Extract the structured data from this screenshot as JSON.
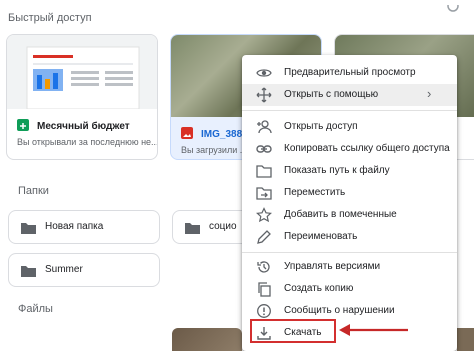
{
  "quick_access": {
    "title": "Быстрый доступ",
    "cards": [
      {
        "name": "Месячный бюджет",
        "subtitle": "Вы открывали за последнюю не...",
        "icon": "sheets-icon",
        "color": "#0f9d58"
      },
      {
        "name": "IMG_3887",
        "subtitle": "Вы загрузили ...",
        "icon": "image-icon",
        "color": "#d93025"
      }
    ],
    "preview_doc_title": "Месячный бюджет"
  },
  "folders": {
    "title": "Папки",
    "items": [
      {
        "label": "Новая папка"
      },
      {
        "label": "социо"
      },
      {
        "label": "Summer"
      }
    ]
  },
  "files": {
    "title": "Файлы"
  },
  "context_menu": {
    "items": [
      {
        "label": "Предварительный просмотр",
        "icon": "eye-icon"
      },
      {
        "label": "Открыть с помощью",
        "icon": "move-arrows-icon",
        "submenu_glyph": "›"
      },
      {
        "label": "Открыть доступ",
        "icon": "add-person-icon"
      },
      {
        "label": "Копировать ссылку общего доступа",
        "icon": "link-icon"
      },
      {
        "label": "Показать путь к файлу",
        "icon": "folder-icon"
      },
      {
        "label": "Переместить",
        "icon": "move-to-folder-icon"
      },
      {
        "label": "Добавить в помеченные",
        "icon": "star-icon"
      },
      {
        "label": "Переименовать",
        "icon": "pencil-icon"
      },
      {
        "label": "Управлять версиями",
        "icon": "history-icon"
      },
      {
        "label": "Создать копию",
        "icon": "copy-icon"
      },
      {
        "label": "Сообщить о нарушении",
        "icon": "report-icon"
      },
      {
        "label": "Скачать",
        "icon": "download-icon"
      }
    ]
  },
  "colors": {
    "highlight_box": "#d32f2f",
    "arrow": "#c62828",
    "folder": "#5f6368"
  }
}
